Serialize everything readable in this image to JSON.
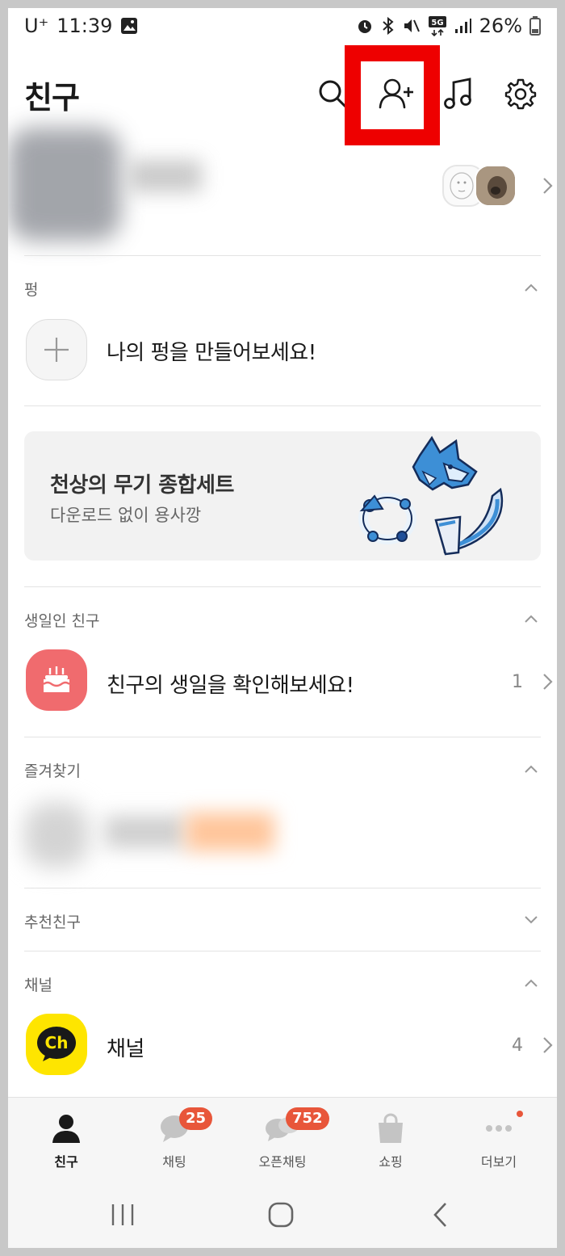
{
  "status_bar": {
    "carrier": "U⁺",
    "time": "11:39",
    "battery": "26%"
  },
  "header": {
    "title": "친구"
  },
  "sections": {
    "pung": {
      "label": "펑",
      "row_text": "나의 펑을 만들어보세요!"
    },
    "banner": {
      "title": "천상의 무기 종합세트",
      "subtitle": "다운로드 없이 용사깡"
    },
    "birthday": {
      "label": "생일인 친구",
      "row_text": "친구의 생일을 확인해보세요!",
      "count": "1"
    },
    "favorites": {
      "label": "즐겨찾기"
    },
    "recommended": {
      "label": "추천친구"
    },
    "channel": {
      "label": "채널",
      "row_text": "채널",
      "icon_text": "Ch",
      "count": "4"
    }
  },
  "tabs": [
    {
      "label": "친구",
      "active": true
    },
    {
      "label": "채팅",
      "badge": "25"
    },
    {
      "label": "오픈채팅",
      "badge": "752"
    },
    {
      "label": "쇼핑"
    },
    {
      "label": "더보기"
    }
  ],
  "colors": {
    "highlight": "#ee0000",
    "badge": "#e8563a",
    "birthday_icon": "#f06b6e",
    "channel_icon": "#fee500"
  }
}
